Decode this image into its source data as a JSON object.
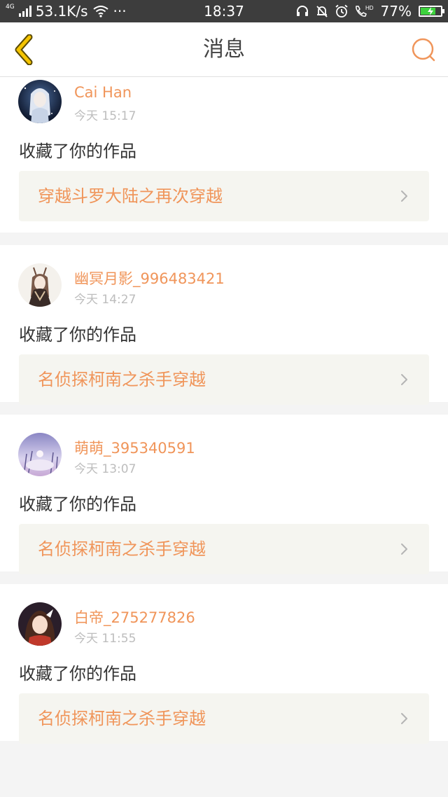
{
  "status_bar": {
    "network_type": "4G",
    "speed": "53.1K/s",
    "dots": "···",
    "time": "18:37",
    "battery": "77%",
    "battery_level": 0.77,
    "hd_label": "HD"
  },
  "header": {
    "title": "消息",
    "back_icon": "chevron-left-icon",
    "search_icon": "search-icon",
    "accent_color": "#f0955a",
    "back_color": "#f5c400"
  },
  "messages": [
    {
      "username": "Cai Han",
      "time": "今天 15:17",
      "action": "收藏了你的作品",
      "work_title": "穿越斗罗大陆之再次穿越"
    },
    {
      "username": "幽冥月影_996483421",
      "time": "今天 14:27",
      "action": "收藏了你的作品",
      "work_title": "名侦探柯南之杀手穿越"
    },
    {
      "username": "萌萌_395340591",
      "time": "今天 13:07",
      "action": "收藏了你的作品",
      "work_title": "名侦探柯南之杀手穿越"
    },
    {
      "username": "白帝_275277826",
      "time": "今天 11:55",
      "action": "收藏了你的作品",
      "work_title": "名侦探柯南之杀手穿越"
    }
  ]
}
